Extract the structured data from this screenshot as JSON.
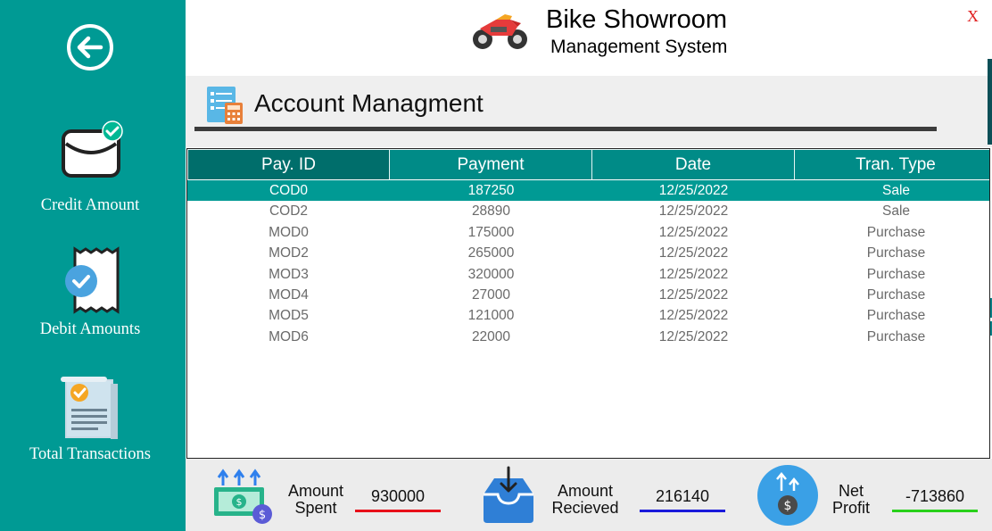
{
  "header": {
    "title": "Bike Showroom",
    "subtitle": "Management System",
    "close_label": "X"
  },
  "sidebar": {
    "back_icon": "back-arrow-icon",
    "items": [
      {
        "label": "Credit Amount",
        "icon": "credit-envelope-icon"
      },
      {
        "label": "Debit Amounts",
        "icon": "receipt-check-icon"
      },
      {
        "label": "Total Transactions",
        "icon": "document-check-icon"
      }
    ]
  },
  "section": {
    "title": "Account Managment",
    "icon": "account-calculator-icon"
  },
  "table": {
    "columns": [
      "Pay. ID",
      "Payment",
      "Date",
      "Tran. Type"
    ],
    "rows": [
      [
        "COD0",
        "187250",
        "12/25/2022",
        "Sale"
      ],
      [
        "COD2",
        "28890",
        "12/25/2022",
        "Sale"
      ],
      [
        "MOD0",
        "175000",
        "12/25/2022",
        "Purchase"
      ],
      [
        "MOD2",
        "265000",
        "12/25/2022",
        "Purchase"
      ],
      [
        "MOD3",
        "320000",
        "12/25/2022",
        "Purchase"
      ],
      [
        "MOD4",
        "27000",
        "12/25/2022",
        "Purchase"
      ],
      [
        "MOD5",
        "121000",
        "12/25/2022",
        "Purchase"
      ],
      [
        "MOD6",
        "22000",
        "12/25/2022",
        "Purchase"
      ]
    ],
    "selected_row": 0
  },
  "footer": {
    "spent": {
      "label_line1": "Amount",
      "label_line2": "Spent",
      "value": "930000",
      "underline_color": "#e8101a"
    },
    "received": {
      "label_line1": "Amount",
      "label_line2": "Recieved",
      "value": "216140",
      "underline_color": "#1a1adb"
    },
    "profit": {
      "label_line1": "Net",
      "label_line2": "Profit",
      "value": "-713860",
      "underline_color": "#29d11b"
    }
  },
  "colors": {
    "sidebar": "#009a94",
    "table_header": "#008b87",
    "selected_row": "#009a94"
  }
}
